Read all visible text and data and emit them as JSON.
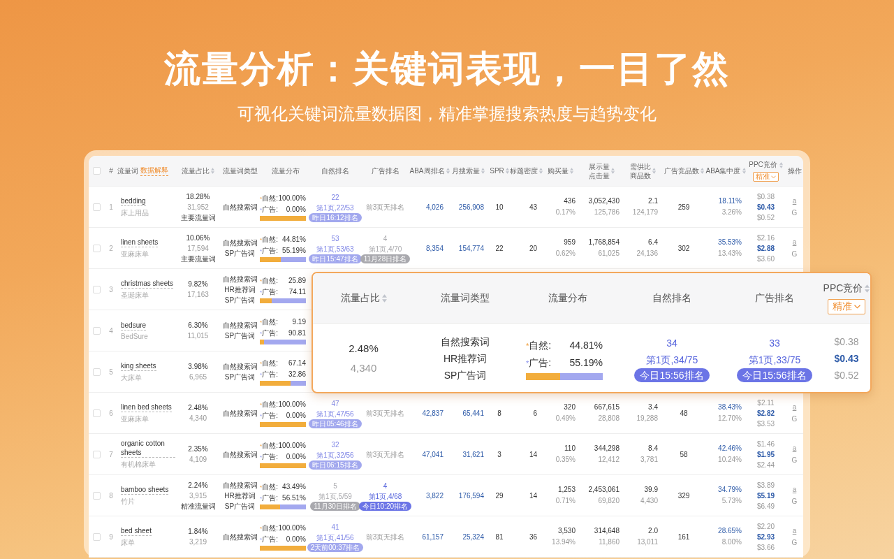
{
  "headline": "流量分析：关键词表现，一目了然",
  "subheadline": "可视化关键词流量数据图，精准掌握搜索热度与趋势变化",
  "table": {
    "header_checked": false,
    "columns": [
      {
        "label": "#",
        "sortable": false
      },
      {
        "label": "流量词",
        "sortable": false,
        "link": "数据解释"
      },
      {
        "label": "流量占比",
        "sortable": true
      },
      {
        "label": "流量词类型",
        "sortable": false
      },
      {
        "label": "流量分布",
        "sortable": false
      },
      {
        "label": "自然排名",
        "sortable": false
      },
      {
        "label": "广告排名",
        "sortable": false
      },
      {
        "label": "ABA周排名",
        "sortable": true
      },
      {
        "label": "月搜索量",
        "sortable": true
      },
      {
        "label": "SPR",
        "sortable": true
      },
      {
        "label": "标题密度",
        "sortable": true
      },
      {
        "label": "购买量",
        "sortable": true
      },
      {
        "label": "展示量",
        "label2": "点击量",
        "sortable": true
      },
      {
        "label": "需供比",
        "label2": "商品数",
        "sortable": true
      },
      {
        "label": "广告竞品数",
        "sortable": true
      },
      {
        "label": "ABA集中度",
        "sortable": true
      },
      {
        "label": "PPC竞价",
        "sortable": true,
        "dropdown": "精准"
      },
      {
        "label": "操作",
        "sortable": false
      }
    ],
    "rows": [
      {
        "checked": false,
        "index": "1",
        "keyword": "bedding",
        "translation": "床上用品",
        "share": "18.28%",
        "count": "31,952",
        "tag": "主要流量词",
        "types": [
          "自然搜索词"
        ],
        "distribution": {
          "items": [
            {
              "mark": "*",
              "label": "自然:",
              "value": "100.00%"
            },
            {
              "mark": "*",
              "label": "广告:",
              "value": "0.00%"
            }
          ],
          "level": 1
        },
        "natural_rank": {
          "rank": "22",
          "page": "第1页,22/53",
          "badge": "昨日16:12排名",
          "outdated": false,
          "today": false
        },
        "ad_rank": {
          "note": "前3页无排名"
        },
        "aba_rank": "4,026",
        "monthly_searches": "256,908",
        "spr": "10",
        "title_density": "43",
        "purchases": "436",
        "purchase_rate": "0.17%",
        "impressions": "3,052,430",
        "clicks": "125,786",
        "supply_demand": "2.1",
        "products": "124,179",
        "ad_competitors": "259",
        "aba_concentration": "18.11%",
        "aba_share": "3.26%",
        "ppc": [
          "$0.38",
          "$0.43",
          "$0.52"
        ],
        "actions": [
          "a",
          "G"
        ]
      },
      {
        "checked": false,
        "index": "2",
        "keyword": "linen sheets",
        "translation": "亚麻床单",
        "share": "10.06%",
        "count": "17,594",
        "tag": "主要流量词",
        "types": [
          "自然搜索词",
          "SP广告词"
        ],
        "distribution": {
          "items": [
            {
              "mark": "*",
              "label": "自然:",
              "value": "44.81%"
            },
            {
              "mark": "*",
              "label": "广告:",
              "value": "55.19%"
            }
          ],
          "level": 0.4481
        },
        "natural_rank": {
          "rank": "53",
          "page": "第1页,53/63",
          "badge": "昨日15:47排名",
          "outdated": false,
          "today": false
        },
        "ad_rank": {
          "rank": "4",
          "page": "第1页,4/70",
          "badge": "11月28日排名",
          "outdated": true
        },
        "aba_rank": "8,354",
        "monthly_searches": "154,774",
        "spr": "22",
        "title_density": "20",
        "purchases": "959",
        "purchase_rate": "0.62%",
        "impressions": "1,768,854",
        "clicks": "61,025",
        "supply_demand": "6.4",
        "products": "24,136",
        "ad_competitors": "302",
        "aba_concentration": "35.53%",
        "aba_share": "13.43%",
        "ppc": [
          "$2.16",
          "$2.88",
          "$3.60"
        ],
        "actions": [
          "a",
          "G"
        ]
      },
      {
        "checked": false,
        "index": "3",
        "keyword": "christmas sheets",
        "translation": "圣诞床单",
        "share": "9.82%",
        "count": "17,163",
        "types": [
          "自然搜索词",
          "HR推荐词",
          "SP广告词"
        ],
        "distribution": {
          "items": [
            {
              "mark": "*",
              "label": "自然:",
              "value": "25.89"
            },
            {
              "mark": "*",
              "label": "广告:",
              "value": "74.11"
            }
          ],
          "level": 0.2589
        }
      },
      {
        "checked": false,
        "index": "4",
        "keyword": "bedsure",
        "translation": "BedSure",
        "share": "6.30%",
        "count": "11,015",
        "types": [
          "自然搜索词",
          "SP广告词"
        ],
        "distribution": {
          "items": [
            {
              "mark": "*",
              "label": "自然:",
              "value": "9.19"
            },
            {
              "mark": "*",
              "label": "广告:",
              "value": "90.81"
            }
          ],
          "level": 0.0919
        }
      },
      {
        "checked": false,
        "index": "5",
        "keyword": "king sheets",
        "translation": "大床单",
        "share": "3.98%",
        "count": "6,965",
        "types": [
          "自然搜索词",
          "SP广告词"
        ],
        "distribution": {
          "items": [
            {
              "mark": "*",
              "label": "自然:",
              "value": "67.14"
            },
            {
              "mark": "*",
              "label": "广告:",
              "value": "32.86"
            }
          ],
          "level": 0.6714
        }
      },
      {
        "checked": false,
        "index": "6",
        "keyword": "linen bed sheets",
        "translation": "亚麻床单",
        "share": "2.48%",
        "count": "4,340",
        "types": [
          "自然搜索词"
        ],
        "distribution": {
          "items": [
            {
              "mark": "*",
              "label": "自然:",
              "value": "100.00%"
            },
            {
              "mark": "*",
              "label": "广告:",
              "value": "0.00%"
            }
          ],
          "level": 1
        },
        "natural_rank": {
          "rank": "47",
          "page": "第1页,47/56",
          "badge": "昨日05:46排名",
          "outdated": false,
          "today": false
        },
        "ad_rank": {
          "note": "前3页无排名"
        },
        "aba_rank": "42,837",
        "monthly_searches": "65,441",
        "spr": "8",
        "title_density": "6",
        "purchases": "320",
        "purchase_rate": "0.49%",
        "impressions": "667,615",
        "clicks": "28,808",
        "supply_demand": "3.4",
        "products": "19,288",
        "ad_competitors": "48",
        "aba_concentration": "38.43%",
        "aba_share": "12.70%",
        "ppc": [
          "$2.11",
          "$2.82",
          "$3.53"
        ],
        "actions": [
          "a",
          "G"
        ]
      },
      {
        "checked": false,
        "index": "7",
        "keyword": "organic cotton sheets",
        "translation": "有机棉床单",
        "share": "2.35%",
        "count": "4,109",
        "types": [
          "自然搜索词"
        ],
        "distribution": {
          "items": [
            {
              "mark": "*",
              "label": "自然:",
              "value": "100.00%"
            },
            {
              "mark": "*",
              "label": "广告:",
              "value": "0.00%"
            }
          ],
          "level": 1
        },
        "natural_rank": {
          "rank": "32",
          "page": "第1页,32/56",
          "badge": "昨日06:15排名",
          "outdated": false,
          "today": false
        },
        "ad_rank": {
          "note": "前3页无排名"
        },
        "aba_rank": "47,041",
        "monthly_searches": "31,621",
        "spr": "3",
        "title_density": "14",
        "purchases": "110",
        "purchase_rate": "0.35%",
        "impressions": "344,298",
        "clicks": "12,412",
        "supply_demand": "8.4",
        "products": "3,781",
        "ad_competitors": "58",
        "aba_concentration": "42.46%",
        "aba_share": "10.24%",
        "ppc": [
          "$1.46",
          "$1.95",
          "$2.44"
        ],
        "actions": [
          "a",
          "G"
        ]
      },
      {
        "checked": false,
        "index": "8",
        "keyword": "bamboo sheets",
        "translation": "竹片",
        "share": "2.24%",
        "count": "3,915",
        "tag": "精准流量词",
        "types": [
          "自然搜索词",
          "HR推荐词",
          "SP广告词"
        ],
        "distribution": {
          "items": [
            {
              "mark": "*",
              "label": "自然:",
              "value": "43.49%"
            },
            {
              "mark": "*",
              "label": "广告:",
              "value": "56.51%"
            }
          ],
          "level": 0.4349
        },
        "natural_rank": {
          "rank": "5",
          "page": "第1页,5/59",
          "badge": "11月30日排名",
          "outdated": true
        },
        "ad_rank": {
          "rank": "4",
          "page": "第1页,4/68",
          "badge": "今日10:20排名",
          "outdated": false,
          "today": true
        },
        "aba_rank": "3,822",
        "monthly_searches": "176,594",
        "spr": "29",
        "title_density": "14",
        "purchases": "1,253",
        "purchase_rate": "0.71%",
        "impressions": "2,453,061",
        "clicks": "69,820",
        "supply_demand": "39.9",
        "products": "4,430",
        "ad_competitors": "329",
        "aba_concentration": "34.79%",
        "aba_share": "5.73%",
        "ppc": [
          "$3.89",
          "$5.19",
          "$6.49"
        ],
        "actions": [
          "a",
          "G"
        ]
      },
      {
        "checked": false,
        "index": "9",
        "keyword": "bed sheet",
        "translation": "床单",
        "share": "1.84%",
        "count": "3,219",
        "types": [
          "自然搜索词"
        ],
        "distribution": {
          "items": [
            {
              "mark": "*",
              "label": "自然:",
              "value": "100.00%"
            },
            {
              "mark": "*",
              "label": "广告:",
              "value": "0.00%"
            }
          ],
          "level": 1
        },
        "natural_rank": {
          "rank": "41",
          "page": "第1页,41/56",
          "badge": "2天前00:37排名",
          "outdated": false,
          "today": false
        },
        "ad_rank": {
          "note": "前3页无排名"
        },
        "aba_rank": "61,157",
        "monthly_searches": "25,324",
        "spr": "81",
        "title_density": "36",
        "purchases": "3,530",
        "purchase_rate": "13.94%",
        "impressions": "314,648",
        "clicks": "11,860",
        "supply_demand": "2.0",
        "products": "13,011",
        "ad_competitors": "161",
        "aba_concentration": "28.65%",
        "aba_share": "8.00%",
        "ppc": [
          "$2.20",
          "$2.93",
          "$3.66"
        ],
        "actions": [
          "a",
          "G"
        ]
      }
    ]
  },
  "zoom_panel": {
    "columns": [
      {
        "label": "流量占比",
        "sortable": true
      },
      {
        "label": "流量词类型",
        "sortable": false
      },
      {
        "label": "流量分布",
        "sortable": false
      },
      {
        "label": "自然排名",
        "sortable": false
      },
      {
        "label": "广告排名",
        "sortable": false
      },
      {
        "label": "PPC竞价",
        "sortable": true,
        "dropdown": "精准"
      }
    ],
    "row": {
      "share": "2.48%",
      "count": "4,340",
      "types": [
        "自然搜索词",
        "HR推荐词",
        "SP广告词"
      ],
      "distribution": {
        "items": [
          {
            "mark": "*",
            "label": "自然:",
            "value": "44.81%"
          },
          {
            "mark": "*",
            "label": "广告:",
            "value": "55.19%"
          }
        ],
        "level": 0.4481
      },
      "natural_rank": {
        "rank": "34",
        "page": "第1页,34/75",
        "badge": "今日15:56排名",
        "outdated": false,
        "today": true
      },
      "ad_rank": {
        "rank": "33",
        "page": "第1页,33/75",
        "badge": "今日15:56排名",
        "outdated": false,
        "today": true
      },
      "ppc": [
        "$0.38",
        "$0.43",
        "$0.52"
      ]
    }
  }
}
